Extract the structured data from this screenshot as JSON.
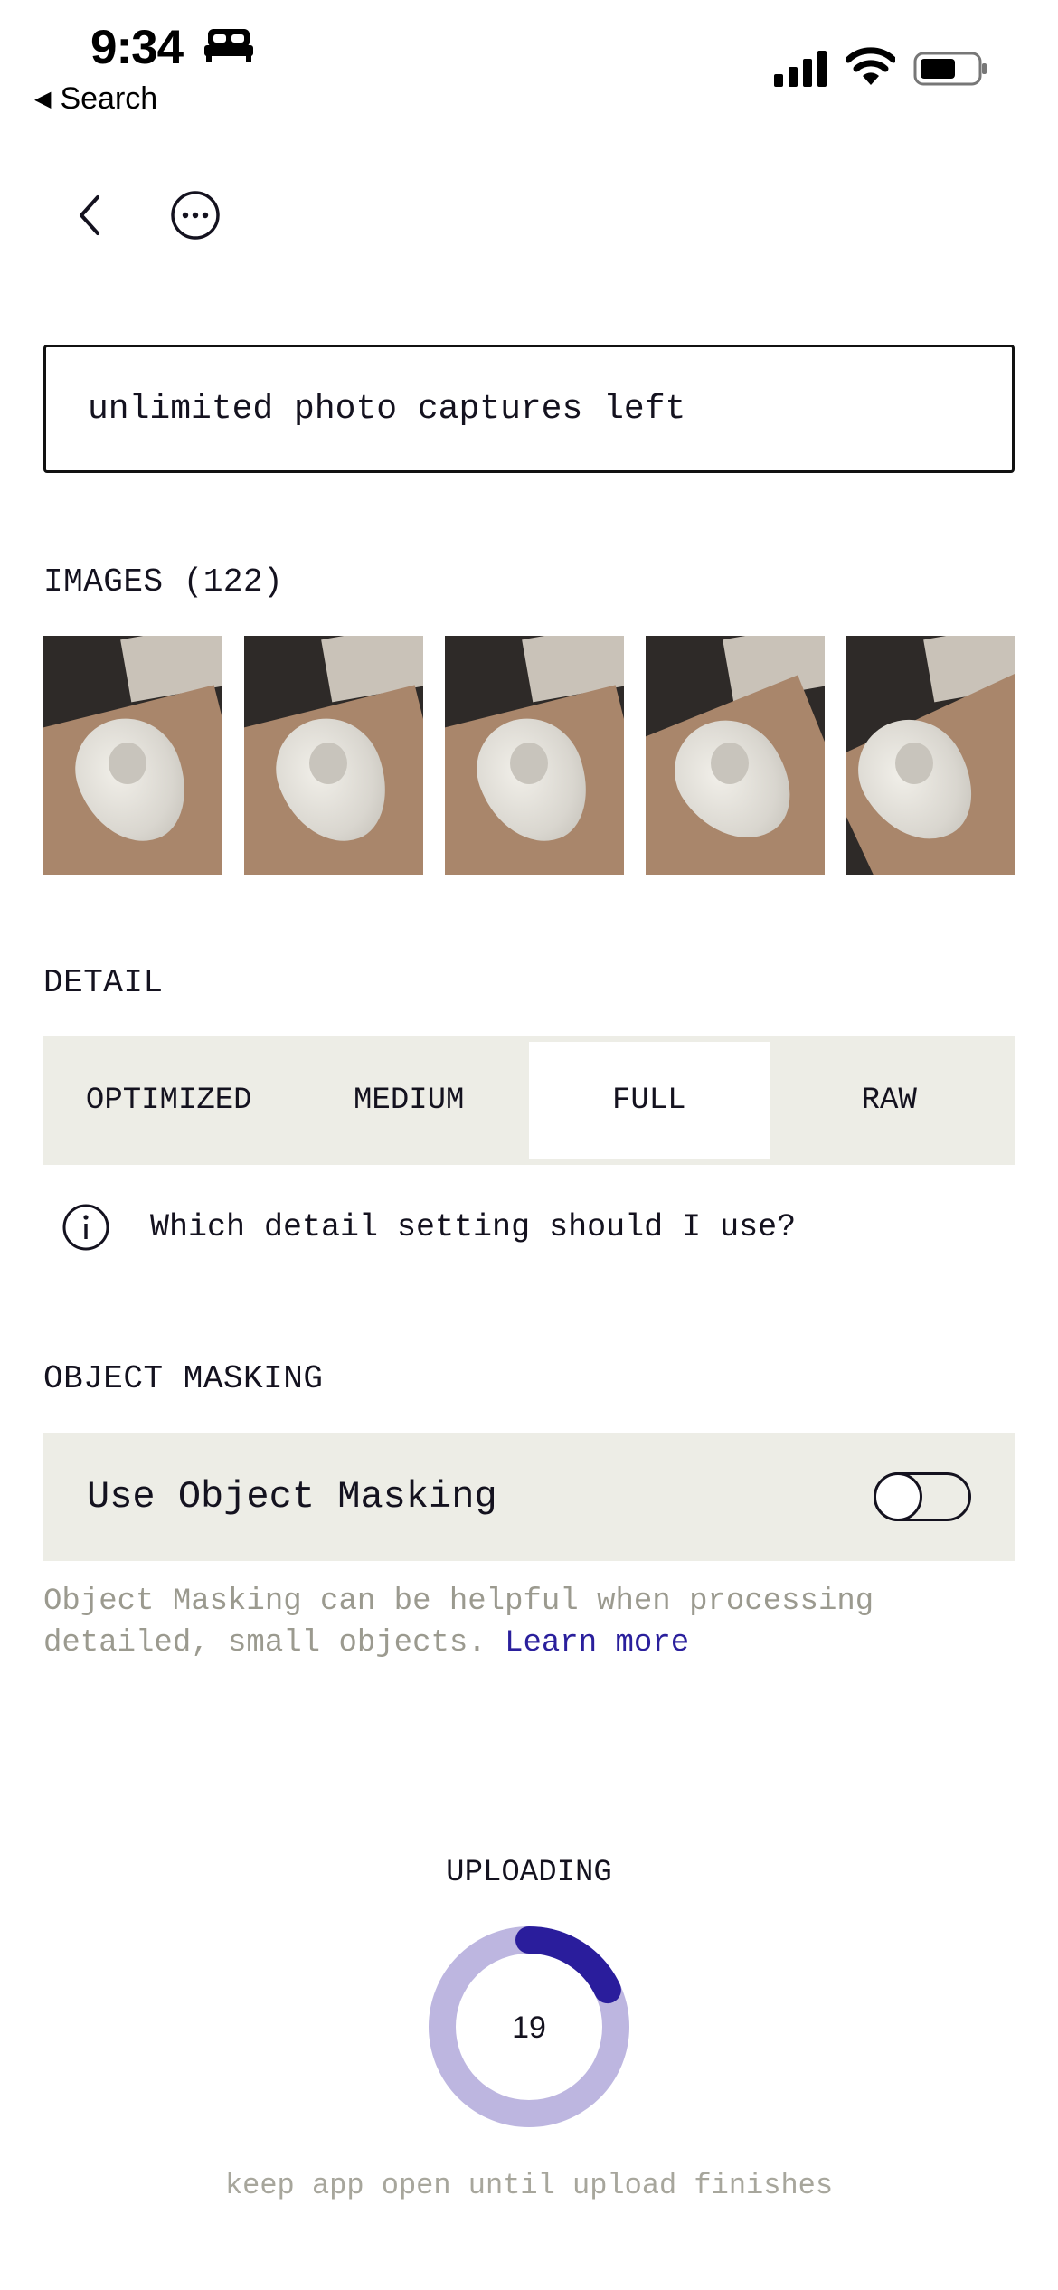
{
  "status_bar": {
    "time": "9:34",
    "back_app_label": "Search",
    "icons": [
      "bed-icon",
      "cellular-signal-icon",
      "wifi-icon",
      "battery-icon"
    ]
  },
  "nav": {
    "icons": [
      "chevron-left-icon",
      "more-options-icon"
    ]
  },
  "captures_banner": "unlimited photo captures left",
  "images": {
    "label": "IMAGES (122)",
    "thumbnail_count_visible": 5
  },
  "detail": {
    "label": "DETAIL",
    "options": [
      "OPTIMIZED",
      "MEDIUM",
      "FULL",
      "RAW"
    ],
    "selected": "FULL",
    "help_text": "Which detail setting should I use?"
  },
  "object_masking": {
    "label": "OBJECT MASKING",
    "toggle_label": "Use Object Masking",
    "toggle_on": false,
    "description": "Object Masking can be helpful when processing detailed, small objects.",
    "link": "Learn more"
  },
  "upload": {
    "label": "UPLOADING",
    "count": "19",
    "progress_fraction": 0.18,
    "note": "keep app open until upload finishes"
  },
  "colors": {
    "progress_track": "#bdb6e0",
    "progress_fill": "#2a1d9c",
    "panel_bg": "#edede6",
    "muted_text": "#9b9a8f",
    "link": "#2a1f9c"
  }
}
